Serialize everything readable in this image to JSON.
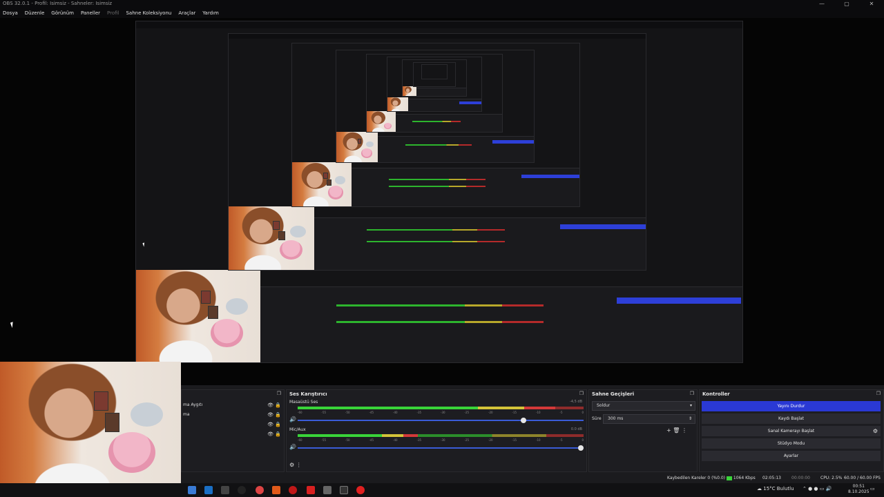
{
  "window": {
    "title": "OBS 32.0.1 - Profil: Isimsiz - Sahneler: Isimsiz",
    "controls": [
      "—",
      "▢",
      "✕"
    ]
  },
  "menu": [
    "Dosya",
    "Düzenle",
    "Görünüm",
    "Paneller",
    "Profil",
    "Sahne Koleksiyonu",
    "Araçlar",
    "Yardım"
  ],
  "sources": {
    "rows": [
      "ma Aygıtı",
      "ma",
      "",
      ""
    ]
  },
  "mixer": {
    "title": "Ses Karıştırıcı",
    "channels": [
      {
        "name": "Masaüstü Ses",
        "db": "-4,5 dB",
        "level": 0.9,
        "volume": 0.8
      },
      {
        "name": "Mic/Aux",
        "db": "0.0 dB",
        "level": 0.42,
        "volume": 1.0
      }
    ],
    "ticks": [
      "-60",
      "-55",
      "-50",
      "-45",
      "-40",
      "-35",
      "-30",
      "-25",
      "-20",
      "-15",
      "-10",
      "-5",
      "0"
    ]
  },
  "transitions": {
    "title": "Sahne Geçişleri",
    "type": "Soldur",
    "duration_label": "Süre",
    "duration": "300 ms"
  },
  "controls": {
    "title": "Kontroller",
    "buttons": [
      "Yayını Durdur",
      "Kaydı Başlat",
      "Sanal Kamerayı Başlat",
      "Stüdyo Modu",
      "Ayarlar"
    ]
  },
  "status": {
    "dropped": "Kaybedilen Kareler 0 (%0.0)",
    "bitrate": "1064 Kbps",
    "stream_time": "02:05:13",
    "rec_time": "00:00:00",
    "cpu": "CPU: 2.5%",
    "fps": "60.00 / 60.00 FPS"
  },
  "taskbar": {
    "weather": "15°C Bulutlu",
    "time": "00:51",
    "date": "8.10.2025"
  },
  "colors": {
    "accent": "#2a39d4",
    "meter_green": "#39d439",
    "meter_yellow": "#d4c439",
    "meter_red": "#d43939"
  }
}
